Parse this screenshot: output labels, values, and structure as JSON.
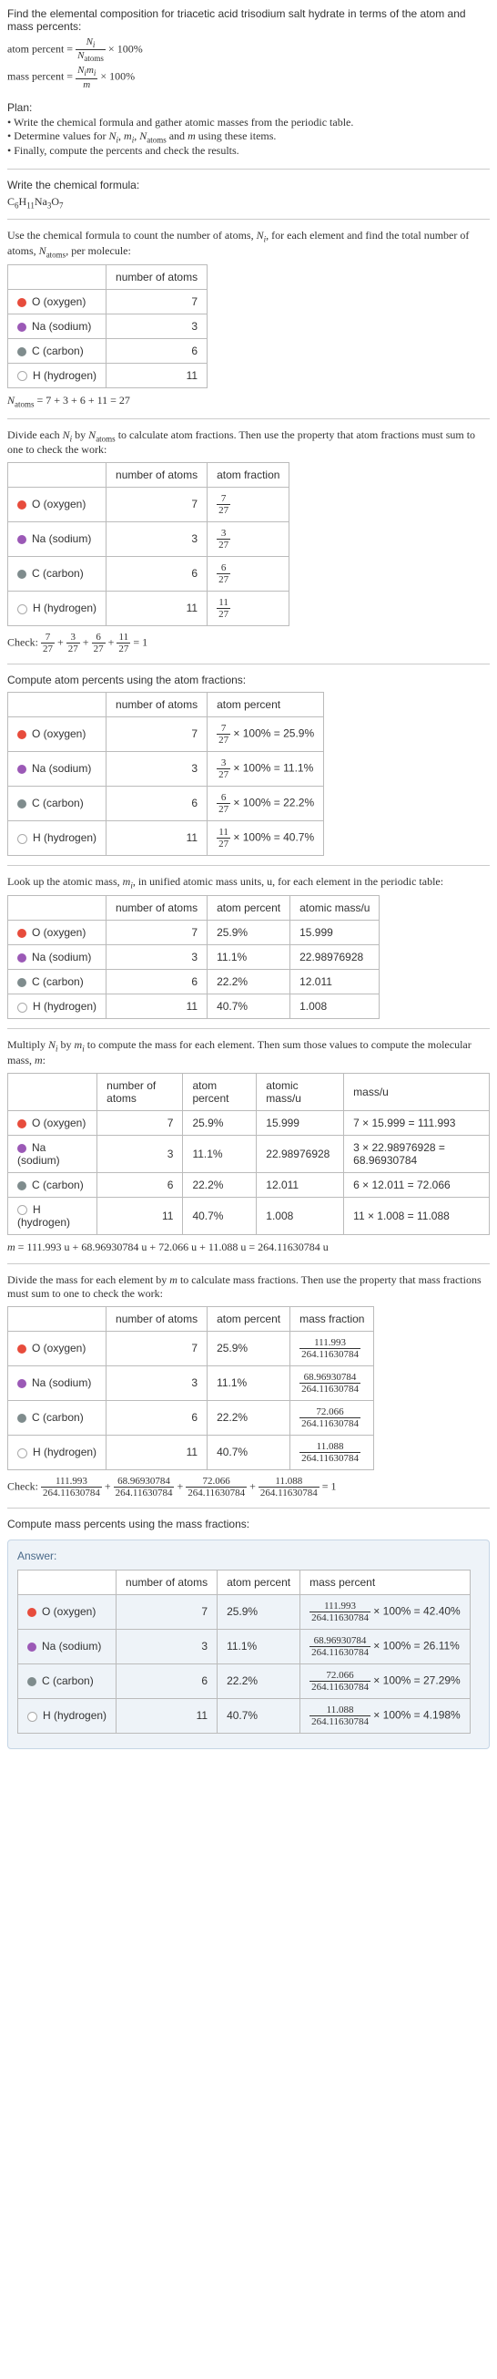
{
  "intro": "Find the elemental composition for triacetic acid trisodium salt hydrate in terms of the atom and mass percents:",
  "atomPercentEq": "atom percent = N_i / N_atoms × 100%",
  "massPercentEq": "mass percent = N_i m_i / m × 100%",
  "planTitle": "Plan:",
  "plan1": "• Write the chemical formula and gather atomic masses from the periodic table.",
  "plan2": "• Determine values for N_i, m_i, N_atoms and m using these items.",
  "plan3": "• Finally, compute the percents and check the results.",
  "writeFormula": "Write the chemical formula:",
  "chemFormula": "C₆H₁₁Na₃O₇",
  "countDesc": "Use the chemical formula to count the number of atoms, N_i, for each element and find the total number of atoms, N_atoms, per molecule:",
  "hdr_num": "number of atoms",
  "hdr_frac": "atom fraction",
  "hdr_pct": "atom percent",
  "hdr_mass": "atomic mass/u",
  "hdr_massu": "mass/u",
  "hdr_massfrac": "mass fraction",
  "hdr_masspct": "mass percent",
  "el": {
    "o": "O (oxygen)",
    "na": "Na (sodium)",
    "c": "C (carbon)",
    "h": "H (hydrogen)"
  },
  "n": {
    "o": "7",
    "na": "3",
    "c": "6",
    "h": "11"
  },
  "natoms": "N_atoms = 7 + 3 + 6 + 11 = 27",
  "fracDesc": "Divide each N_i by N_atoms to calculate atom fractions. Then use the property that atom fractions must sum to one to check the work:",
  "af": {
    "o_n": "7",
    "o_d": "27",
    "na_n": "3",
    "na_d": "27",
    "c_n": "6",
    "c_d": "27",
    "h_n": "11",
    "h_d": "27"
  },
  "check1": "Check: 7/27 + 3/27 + 6/27 + 11/27 = 1",
  "pctDesc": "Compute atom percents using the atom fractions:",
  "ap": {
    "o": "7/27 × 100% = 25.9%",
    "na": "3/27 × 100% = 11.1%",
    "c": "6/27 × 100% = 22.2%",
    "h": "11/27 × 100% = 40.7%"
  },
  "apShort": {
    "o": "25.9%",
    "na": "11.1%",
    "c": "22.2%",
    "h": "40.7%"
  },
  "massDesc": "Look up the atomic mass, m_i, in unified atomic mass units, u, for each element in the periodic table:",
  "am": {
    "o": "15.999",
    "na": "22.98976928",
    "c": "12.011",
    "h": "1.008"
  },
  "multDesc": "Multiply N_i by m_i to compute the mass for each element. Then sum those values to compute the molecular mass, m:",
  "mu": {
    "o": "7 × 15.999 = 111.993",
    "na": "3 × 22.98976928 = 68.96930784",
    "c": "6 × 12.011 = 72.066",
    "h": "11 × 1.008 = 11.088"
  },
  "mtotal": "m = 111.993 u + 68.96930784 u + 72.066 u + 11.088 u = 264.11630784 u",
  "massFracDesc": "Divide the mass for each element by m to calculate mass fractions. Then use the property that mass fractions must sum to one to check the work:",
  "mf": {
    "o_n": "111.993",
    "na_n": "68.96930784",
    "c_n": "72.066",
    "h_n": "11.088",
    "d": "264.11630784"
  },
  "check2": "Check: 111.993/264.11630784 + 68.96930784/264.11630784 + 72.066/264.11630784 + 11.088/264.11630784 = 1",
  "massPctDesc": "Compute mass percents using the mass fractions:",
  "answerLabel": "Answer:",
  "mp": {
    "o": "111.993/264.11630784 × 100% = 42.40%",
    "na": "68.96930784/264.11630784 × 100% = 26.11%",
    "c": "72.066/264.11630784 × 100% = 27.29%",
    "h": "11.088/264.11630784 × 100% = 4.198%"
  },
  "chart_data": [
    {
      "type": "table",
      "title": "number of atoms",
      "categories": [
        "O",
        "Na",
        "C",
        "H"
      ],
      "values": [
        7,
        3,
        6,
        11
      ]
    },
    {
      "type": "table",
      "title": "atom fraction",
      "categories": [
        "O",
        "Na",
        "C",
        "H"
      ],
      "values": [
        0.2593,
        0.1111,
        0.2222,
        0.4074
      ]
    },
    {
      "type": "table",
      "title": "atom percent",
      "categories": [
        "O",
        "Na",
        "C",
        "H"
      ],
      "values": [
        25.9,
        11.1,
        22.2,
        40.7
      ]
    },
    {
      "type": "table",
      "title": "atomic mass/u",
      "categories": [
        "O",
        "Na",
        "C",
        "H"
      ],
      "values": [
        15.999,
        22.98976928,
        12.011,
        1.008
      ]
    },
    {
      "type": "table",
      "title": "mass/u",
      "categories": [
        "O",
        "Na",
        "C",
        "H"
      ],
      "values": [
        111.993,
        68.96930784,
        72.066,
        11.088
      ]
    },
    {
      "type": "table",
      "title": "mass fraction",
      "categories": [
        "O",
        "Na",
        "C",
        "H"
      ],
      "values": [
        0.424,
        0.2611,
        0.2729,
        0.04198
      ]
    },
    {
      "type": "table",
      "title": "mass percent",
      "categories": [
        "O",
        "Na",
        "C",
        "H"
      ],
      "values": [
        42.4,
        26.11,
        27.29,
        4.198
      ]
    }
  ]
}
